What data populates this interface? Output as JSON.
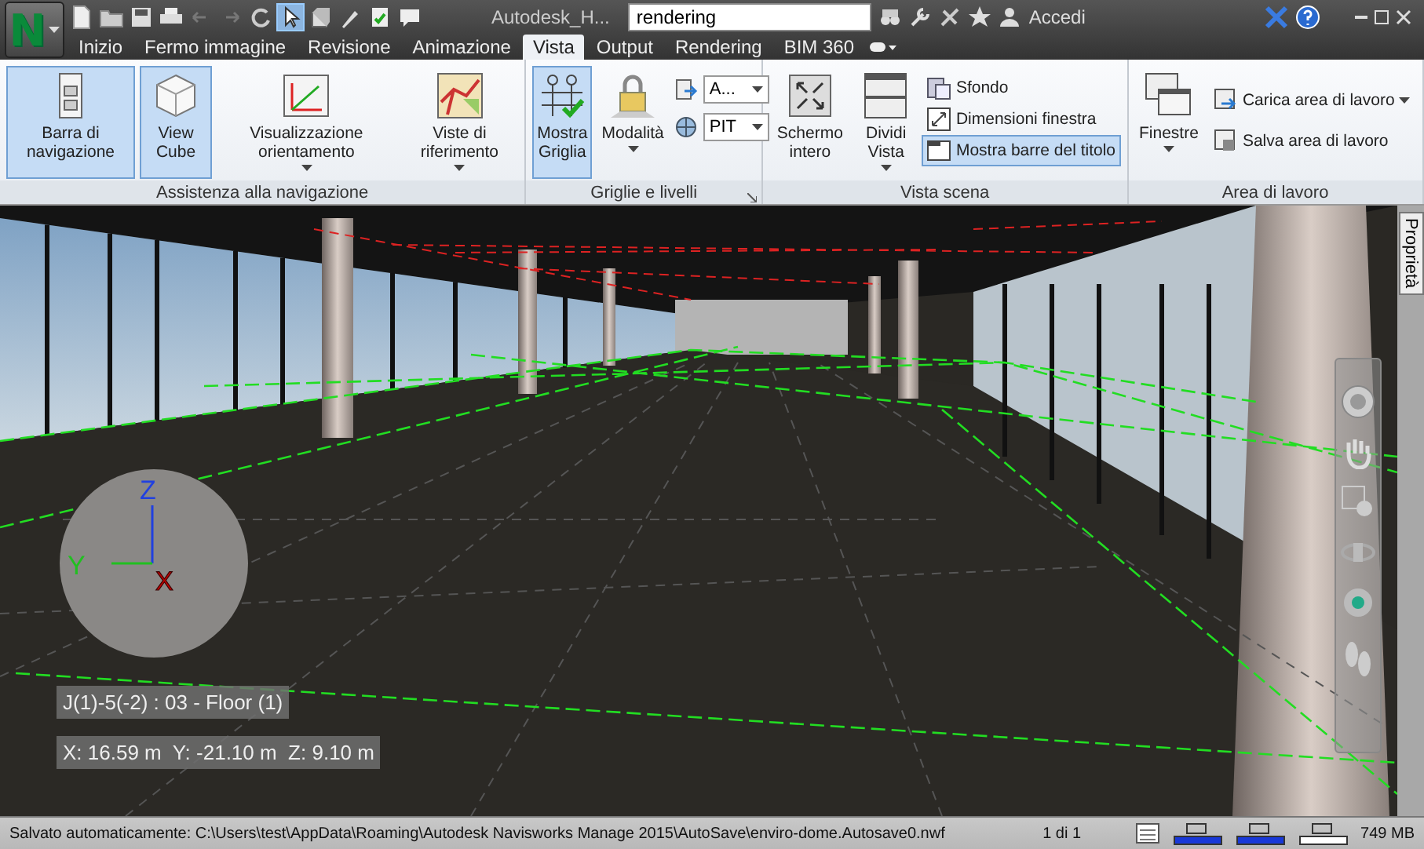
{
  "app_button": {
    "letter": "N"
  },
  "title_bar": {
    "title": "Autodesk_H...",
    "search": {
      "value": "rendering"
    },
    "sign_in": "Accedi"
  },
  "tabs": [
    {
      "label": "Inizio",
      "selected": false
    },
    {
      "label": "Fermo immagine",
      "selected": false
    },
    {
      "label": "Revisione",
      "selected": false
    },
    {
      "label": "Animazione",
      "selected": false
    },
    {
      "label": "Vista",
      "selected": true
    },
    {
      "label": "Output",
      "selected": false
    },
    {
      "label": "Rendering",
      "selected": false
    },
    {
      "label": "BIM 360",
      "selected": false
    }
  ],
  "ribbon_panels": [
    {
      "title": "Assistenza alla navigazione",
      "launcher": false,
      "items": [
        {
          "kind": "large",
          "label": "Barra di navigazione",
          "selected": true,
          "dropdown": false
        },
        {
          "kind": "large",
          "label": "View Cube",
          "selected": true,
          "dropdown": false
        },
        {
          "kind": "large",
          "label": "Visualizzazione orientamento",
          "selected": false,
          "dropdown": true
        },
        {
          "kind": "large",
          "label": "Viste di riferimento",
          "selected": false,
          "dropdown": true
        }
      ]
    },
    {
      "title": "Griglie e livelli",
      "launcher": true,
      "items": [
        {
          "kind": "large",
          "label": "Mostra Griglia",
          "selected": true,
          "dropdown": false
        },
        {
          "kind": "large",
          "label": "Modalità",
          "selected": false,
          "dropdown": true
        },
        {
          "kind": "combo",
          "value": "A..."
        },
        {
          "kind": "combo",
          "value": "PIT"
        }
      ]
    },
    {
      "title": "Vista scena",
      "launcher": false,
      "items": [
        {
          "kind": "large",
          "label": "Schermo intero",
          "selected": false,
          "dropdown": false
        },
        {
          "kind": "large",
          "label": "Dividi Vista",
          "selected": false,
          "dropdown": true
        },
        {
          "kind": "small",
          "label": "Sfondo",
          "selected": false,
          "dropdown": false
        },
        {
          "kind": "small",
          "label": "Dimensioni finestra",
          "selected": false,
          "dropdown": false
        },
        {
          "kind": "small",
          "label": "Mostra barre del titolo",
          "selected": true,
          "dropdown": false
        }
      ]
    },
    {
      "title": "Area di lavoro",
      "launcher": false,
      "items": [
        {
          "kind": "large",
          "label": "Finestre",
          "selected": false,
          "dropdown": true
        },
        {
          "kind": "small",
          "label": "Carica area di lavoro",
          "selected": false,
          "dropdown": true
        },
        {
          "kind": "small",
          "label": "Salva area di lavoro",
          "selected": false,
          "dropdown": false
        }
      ]
    }
  ],
  "viewport": {
    "axes": [
      "X",
      "Y",
      "Z"
    ],
    "grid_location": "J(1)-5(-2) : 03 - Floor (1)",
    "coordinates": "X: 16.59 m  Y: -21.10 m  Z: 9.10 m",
    "side_tab": "Proprietà"
  },
  "status_bar": {
    "message": "Salvato automaticamente: C:\\Users\\test\\AppData\\Roaming\\Autodesk Navisworks Manage 2015\\AutoSave\\enviro-dome.Autosave0.nwf",
    "page": "1 di 1",
    "memory": "749 MB"
  }
}
